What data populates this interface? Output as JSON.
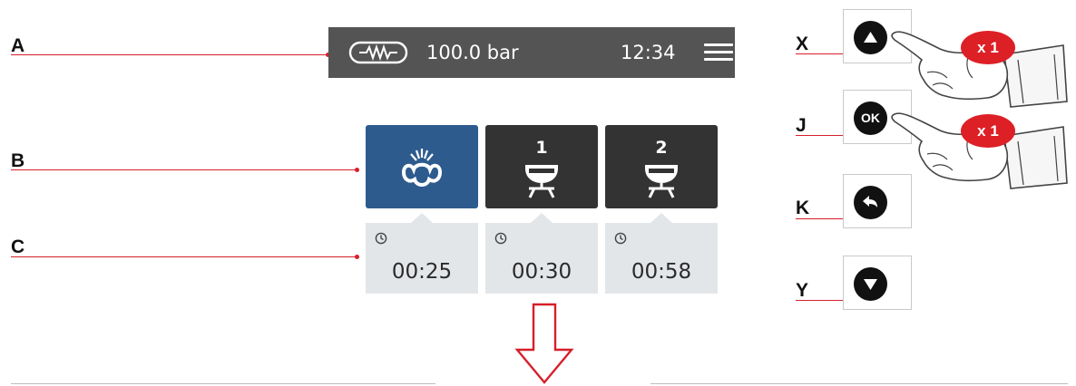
{
  "callouts": {
    "a": "A",
    "b": "B",
    "c": "C",
    "x": "X",
    "j": "J",
    "k": "K",
    "y": "Y"
  },
  "status_bar": {
    "pressure": "100.0 bar",
    "time": "12:34",
    "pressure_icon": "pressure-gauge-icon",
    "menu_icon": "hamburger-menu-icon",
    "background": "#545454"
  },
  "programs": [
    {
      "number": "",
      "icon": "rinse-icon",
      "timer": "00:25",
      "state": "selected",
      "color": "#2e5b8e"
    },
    {
      "number": "1",
      "icon": "group-1-cup-icon",
      "timer": "00:30",
      "state": "default",
      "color": "#333333"
    },
    {
      "number": "2",
      "icon": "group-2-cup-icon",
      "timer": "00:58",
      "state": "default",
      "color": "#333333"
    }
  ],
  "controls": {
    "up": {
      "icon": "up-arrow-icon"
    },
    "ok": {
      "label": "OK"
    },
    "back": {
      "icon": "back-arrow-icon"
    },
    "down": {
      "icon": "down-arrow-icon"
    }
  },
  "press_badges": {
    "up": "x 1",
    "ok": "x 1"
  },
  "colors": {
    "accent_red": "#d61f2a",
    "panel_grey": "#e3e6e9"
  }
}
